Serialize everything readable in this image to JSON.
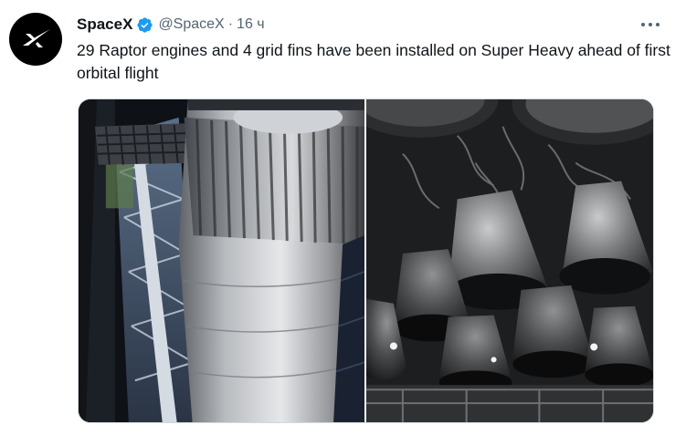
{
  "tweet": {
    "author_name": "SpaceX",
    "handle": "@SpaceX",
    "separator": "·",
    "time": "16 ч",
    "text": "29 Raptor engines and 4 grid fins have been installed on Super Heavy ahead of first orbital flight",
    "icons": {
      "avatar": "spacex-logo-icon",
      "verified": "verified-badge-icon",
      "more": "more-options-icon"
    },
    "colors": {
      "verified_blue": "#1d9bf0",
      "secondary_text": "#536471",
      "primary_text": "#0f1419"
    }
  }
}
